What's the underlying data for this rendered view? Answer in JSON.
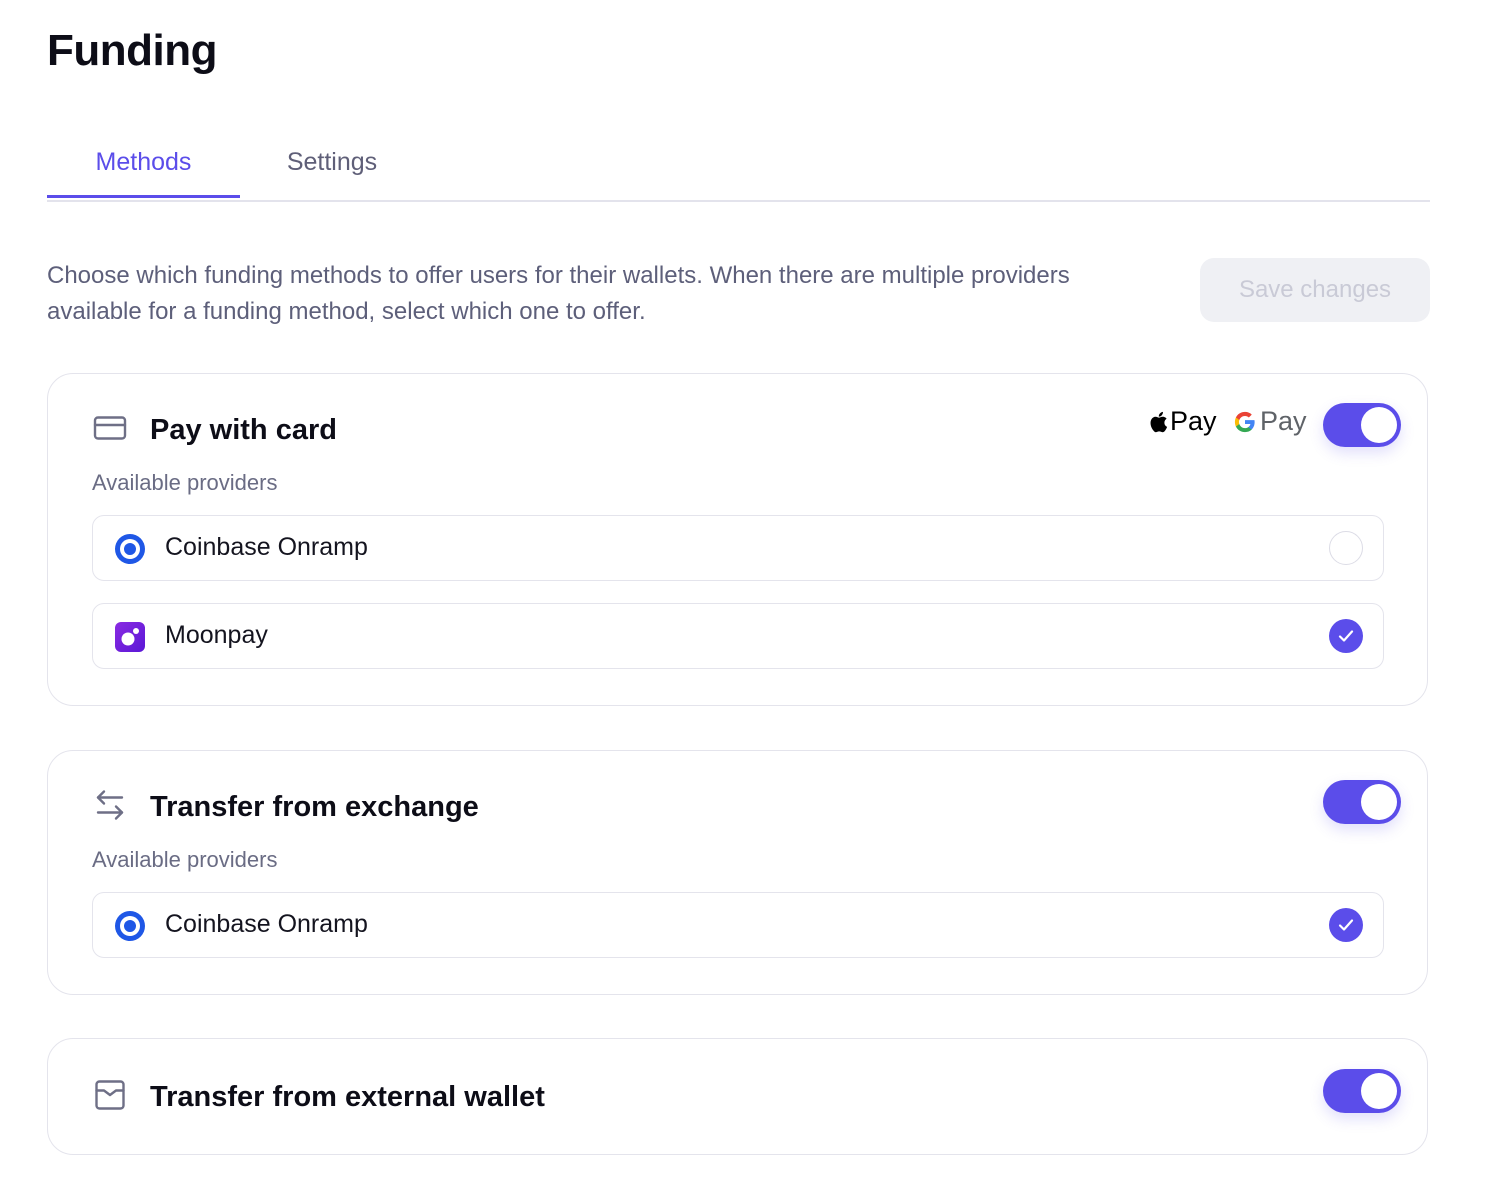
{
  "page": {
    "title": "Funding"
  },
  "tabs": [
    {
      "label": "Methods",
      "active": true
    },
    {
      "label": "Settings",
      "active": false
    }
  ],
  "intro": {
    "text": "Choose which funding methods to offer users for their wallets. When there are multiple providers available for a funding method, select which one to offer."
  },
  "save_button": {
    "label": "Save changes",
    "enabled": false
  },
  "colors": {
    "accent": "#5b4dea",
    "muted_text": "#5d5f7a",
    "border": "#e4e4ec"
  },
  "methods": [
    {
      "title": "Pay with card",
      "icon": "credit-card-icon",
      "enabled": true,
      "badges": {
        "apple_pay": "Pay",
        "google_pay": "Pay"
      },
      "providers_label": "Available providers",
      "providers": [
        {
          "name": "Coinbase Onramp",
          "logo": "coinbase-logo-icon",
          "selected": false
        },
        {
          "name": "Moonpay",
          "logo": "moonpay-logo-icon",
          "selected": true
        }
      ]
    },
    {
      "title": "Transfer from exchange",
      "icon": "arrows-swap-icon",
      "enabled": true,
      "providers_label": "Available providers",
      "providers": [
        {
          "name": "Coinbase Onramp",
          "logo": "coinbase-logo-icon",
          "selected": true
        }
      ]
    },
    {
      "title": "Transfer from external wallet",
      "icon": "wallet-icon",
      "enabled": true
    }
  ]
}
